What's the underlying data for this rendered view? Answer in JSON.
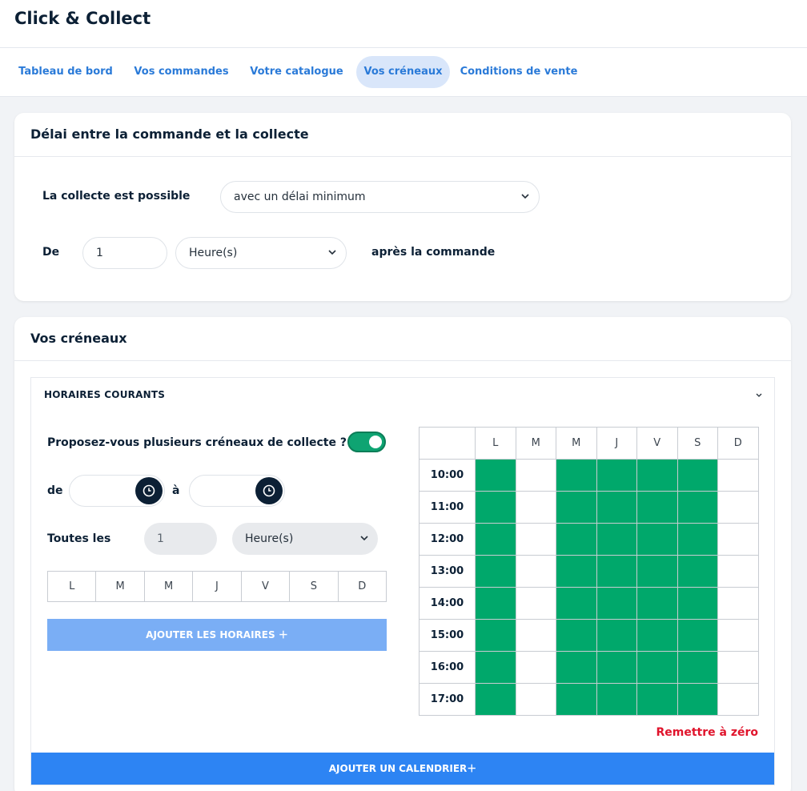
{
  "app": {
    "title": "Click & Collect"
  },
  "nav": {
    "tabs": [
      {
        "label": "Tableau de bord"
      },
      {
        "label": "Vos commandes"
      },
      {
        "label": "Votre catalogue"
      },
      {
        "label": "Vos créneaux",
        "active": true
      },
      {
        "label": "Conditions de vente"
      }
    ]
  },
  "delay": {
    "title": "Délai entre la commande et la collecte",
    "possible_label": "La collecte est possible",
    "mode_value": "avec un délai minimum",
    "from_label": "De",
    "amount_value": "1",
    "unit_value": "Heure(s)",
    "after_label": "après la commande"
  },
  "slots": {
    "title": "Vos créneaux",
    "section": {
      "title": "HORAIRES COURANTS",
      "multiple_question": "Proposez-vous plusieurs créneaux de collecte ?",
      "multiple_enabled": true,
      "from_label": "de",
      "to_label": "à",
      "every_label": "Toutes les",
      "every_value": "1",
      "every_unit": "Heure(s)",
      "days": [
        "L",
        "M",
        "M",
        "J",
        "V",
        "S",
        "D"
      ],
      "add_button": "AJOUTER LES HORAIRES ＋",
      "grid": {
        "days": [
          "L",
          "M",
          "M",
          "J",
          "V",
          "S",
          "D"
        ],
        "hours": [
          "10:00",
          "11:00",
          "12:00",
          "13:00",
          "14:00",
          "15:00",
          "16:00",
          "17:00"
        ],
        "active_days": [
          true,
          false,
          true,
          true,
          true,
          true,
          false
        ]
      },
      "reset_label": "Remettre à zéro"
    },
    "calendar_button": "AJOUTER UN CALENDRIER＋"
  },
  "colors": {
    "accent": "#2d84f3",
    "slot_on": "#00a86b",
    "reset": "#e0142c",
    "toggle": "#0ea472"
  }
}
